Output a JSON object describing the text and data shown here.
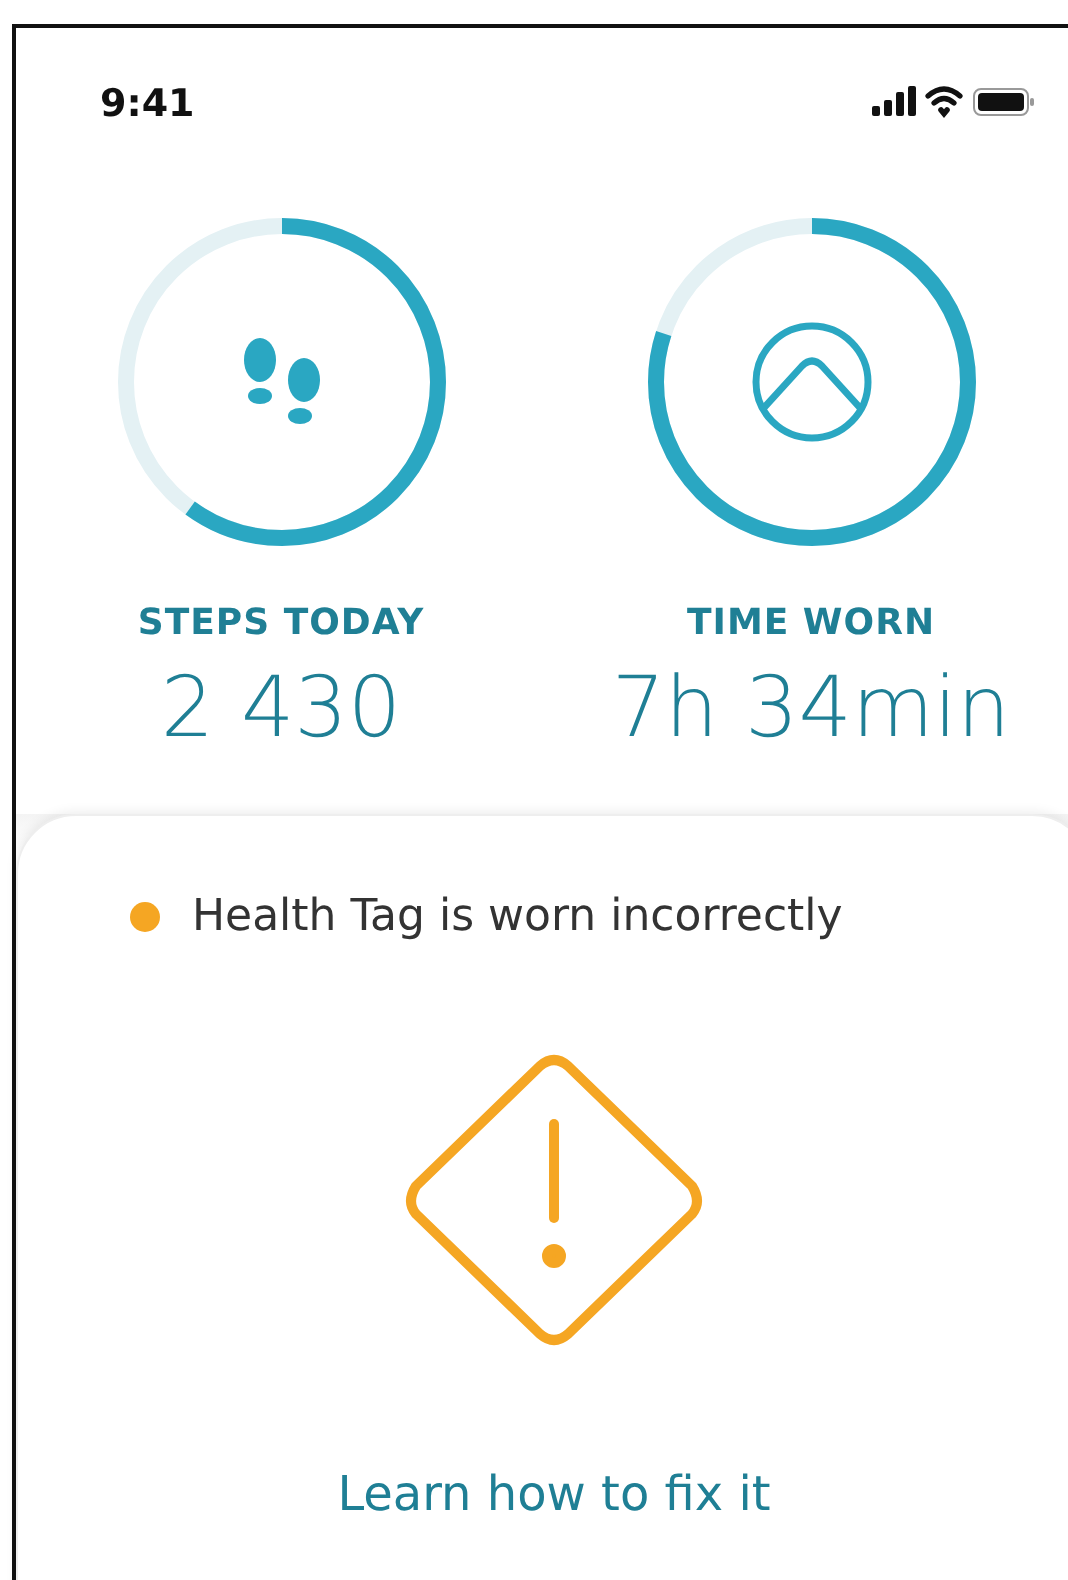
{
  "status_bar": {
    "time": "9:41"
  },
  "metrics": [
    {
      "kind": "steps",
      "label": "STEPS TODAY",
      "value": "2 430",
      "level": 0.6
    },
    {
      "kind": "time",
      "label": "TIME WORN",
      "value": "7h 34min",
      "level": 0.8
    }
  ],
  "alert": {
    "message": "Health Tag is worn incorrectly",
    "link": "Learn how to fix it"
  }
}
